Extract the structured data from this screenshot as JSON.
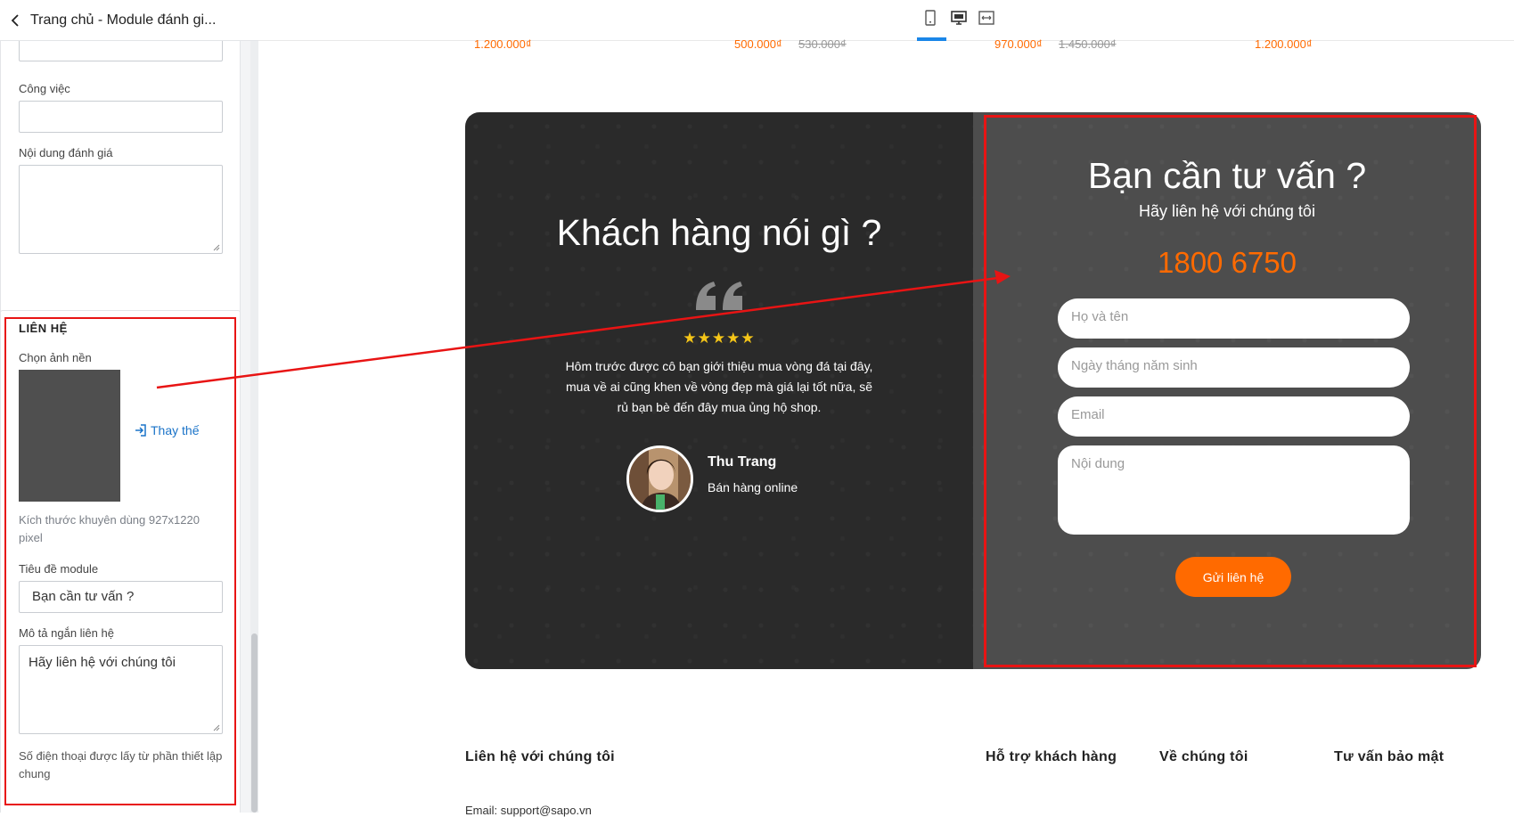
{
  "sidebar": {
    "header_title": "Trang chủ - Module đánh gi...",
    "fields": {
      "job_label": "Công việc",
      "job_value": "",
      "review_content_label": "Nội dung đánh giá",
      "review_content_value": ""
    },
    "contact_section": {
      "title": "LIÊN HỆ",
      "bg_label": "Chọn ảnh nền",
      "replace_label": "Thay thế",
      "size_hint": "Kích thước khuyên dùng 927x1220 pixel",
      "module_title_label": "Tiêu đề module",
      "module_title_value": "Bạn cần tư vấn ?",
      "short_desc_label": "Mô tả ngắn liên hệ",
      "short_desc_value": "Hãy liên hệ với chúng tôi",
      "phone_note": "Số điện thoại được lấy từ phần thiết lập chung"
    }
  },
  "topbar": {
    "devices": [
      "mobile-icon",
      "desktop-icon",
      "fullwidth-icon"
    ],
    "active_device": "desktop"
  },
  "products_strip": {
    "prices": [
      "1.200.000₫",
      "500.000₫",
      "970.000₫",
      "1.200.000₫"
    ],
    "old_prices": [
      "530.000₫",
      "1.450.000₫"
    ]
  },
  "testimonial": {
    "heading": "Khách hàng nói gì ?",
    "stars": "★★★★★",
    "rating": 5,
    "text": "Hôm trước được cô bạn giới thiệu mua vòng đá tại đây, mua về ai cũng khen về vòng đẹp mà giá lại tốt nữa, sẽ rủ bạn bè đến đây mua ủng hộ shop.",
    "name": "Thu Trang",
    "role": "Bán hàng online"
  },
  "contact_form": {
    "title": "Bạn cần tư vấn ?",
    "subtitle": "Hãy liên hệ với chúng tôi",
    "phone": "1800 6750",
    "name_placeholder": "Họ và tên",
    "dob_placeholder": "Ngày tháng năm sinh",
    "email_placeholder": "Email",
    "content_placeholder": "Nội dung",
    "submit_label": "Gửi liên hệ"
  },
  "footer": {
    "col1": "Liên hệ với chúng tôi",
    "col2": "Hỗ trợ khách hàng",
    "col3": "Về chúng tôi",
    "col4": "Tư vấn bảo mật",
    "email_partial": "Email: support@sapo.vn"
  },
  "colors": {
    "accent_orange": "#ff6a00",
    "highlight_red": "#e81414",
    "link_blue": "#1a73c8",
    "dark_panel": "#2a2a2a",
    "grey_panel": "#4d4d4d"
  }
}
